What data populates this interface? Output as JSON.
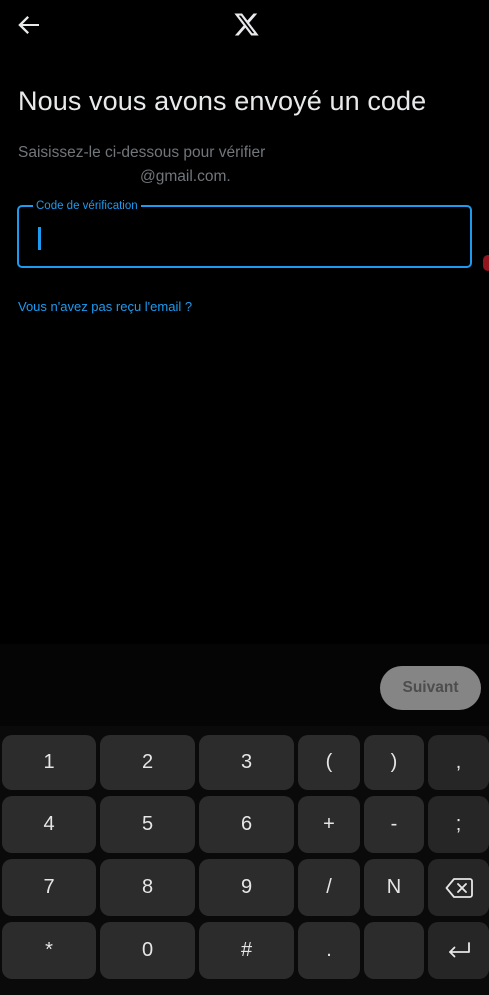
{
  "header": {
    "back_icon": "arrow-left-icon",
    "logo": "x-logo-icon"
  },
  "main": {
    "title": "Nous vous avons envoyé un code",
    "subtitle_line1": "Saisissez-le ci-dessous pour vérifier",
    "subtitle_line2": "@gmail.com.",
    "field_label": "Code de vérification",
    "field_value": "",
    "resend_link": "Vous n'avez pas reçu l'email ?"
  },
  "actions": {
    "next_label": "Suivant"
  },
  "keyboard": {
    "rows": [
      [
        "1",
        "2",
        "3",
        "(",
        ")",
        ","
      ],
      [
        "4",
        "5",
        "6",
        "+",
        "-",
        ";"
      ],
      [
        "7",
        "8",
        "9",
        "/",
        "N",
        "backspace-icon"
      ],
      [
        "*",
        "0",
        "#",
        ".",
        "",
        "enter-icon"
      ]
    ]
  },
  "colors": {
    "accent": "#1d9bf0",
    "background": "#000000",
    "text": "#e7e9ea",
    "muted": "#71767b",
    "button_disabled": "#858585",
    "key": "#2c2c2c"
  }
}
